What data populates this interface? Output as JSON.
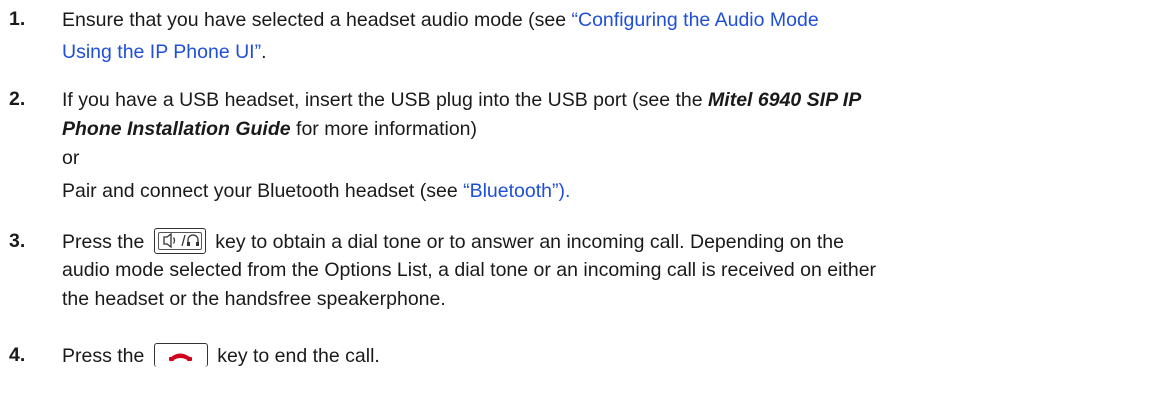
{
  "steps": [
    {
      "number": "1.",
      "line1_text": "Ensure that you have selected a headset audio mode (see ",
      "line1_link": "“Configuring the Audio Mode",
      "line2_link": "Using the IP Phone UI”",
      "line2_text": "."
    },
    {
      "number": "2.",
      "line1_text": "If you have a USB headset, insert the USB plug into the USB port (see the ",
      "line1_bold": "Mitel 6940 SIP IP",
      "line2_bold": "Phone Installation Guide",
      "line2_text": " for more information)",
      "line3_text": "or",
      "line4_text": "Pair and connect your Bluetooth headset (see ",
      "line4_link": "“Bluetooth”)."
    },
    {
      "number": "3.",
      "line1_pre": "Press the",
      "line1_icon": "speaker-headset-key-icon",
      "line1_post": "key to obtain a dial tone or to answer an incoming call. Depending on the",
      "line2_text": "audio mode selected from the Options List, a dial tone or an incoming call is received on either",
      "line3_text": "the headset or the handsfree speakerphone."
    },
    {
      "number": "4.",
      "line1_pre": "Press the",
      "line1_icon": "goodbye-key-icon",
      "line1_post": "key to end the call."
    }
  ],
  "colors": {
    "link": "#1f4fd8",
    "text": "#1a1a1a",
    "hangup_red": "#d0021b"
  }
}
